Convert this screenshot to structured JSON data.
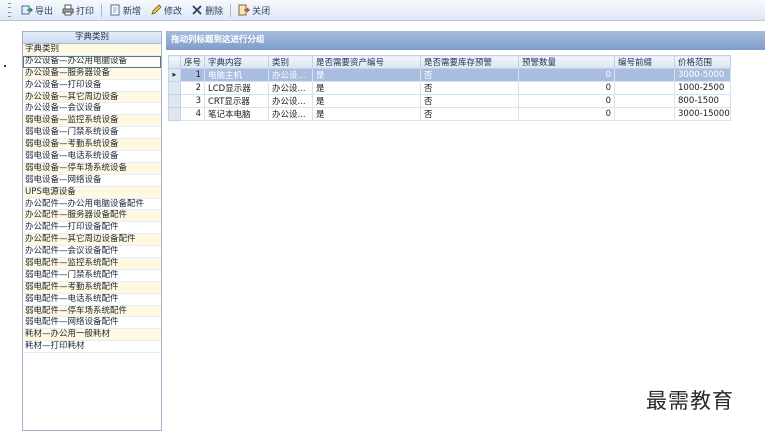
{
  "toolbar": {
    "export": "导出",
    "print": "打印",
    "new": "新增",
    "edit": "修改",
    "delete": "删除",
    "close": "关闭"
  },
  "left": {
    "header": "字典类别",
    "items": [
      "字典类别",
      "办公设备—办公用电脑设备",
      "办公设备—服务器设备",
      "办公设备—打印设备",
      "办公设备—其它周边设备",
      "办公设备—会议设备",
      "弱电设备—监控系统设备",
      "弱电设备—门禁系统设备",
      "弱电设备—考勤系统设备",
      "弱电设备—电话系统设备",
      "弱电设备—停车场系统设备",
      "弱电设备—网络设备",
      "UPS电源设备",
      "办公配件—办公用电脑设备配件",
      "办公配件—服务器设备配件",
      "办公配件—打印设备配件",
      "办公配件—其它周边设备配件",
      "办公配件—会议设备配件",
      "弱电配件—监控系统配件",
      "弱电配件—门禁系统配件",
      "弱电配件—考勤系统配件",
      "弱电配件—电话系统配件",
      "弱电配件—停车场系统配件",
      "弱电配件—网络设备配件",
      "耗材—办公用一般耗材",
      "耗材—打印耗材"
    ]
  },
  "grid": {
    "group_hint": "拖动列标题到这进行分组",
    "columns": [
      "序号",
      "字典内容",
      "类别",
      "是否需要资产编号",
      "是否需要库存预警",
      "预警数量",
      "编号前缀",
      "价格范围"
    ],
    "rows": [
      {
        "seq": "1",
        "content": "电脑主机",
        "category": "办公设...",
        "need_asset_no": "是",
        "need_alert": "否",
        "alert_qty": "0",
        "prefix": "",
        "price": "3000-5000"
      },
      {
        "seq": "2",
        "content": "LCD显示器",
        "category": "办公设...",
        "need_asset_no": "是",
        "need_alert": "否",
        "alert_qty": "0",
        "prefix": "",
        "price": "1000-2500"
      },
      {
        "seq": "3",
        "content": "CRT显示器",
        "category": "办公设...",
        "need_asset_no": "是",
        "need_alert": "否",
        "alert_qty": "0",
        "prefix": "",
        "price": "800-1500"
      },
      {
        "seq": "4",
        "content": "笔记本电脑",
        "category": "办公设...",
        "need_asset_no": "是",
        "need_alert": "否",
        "alert_qty": "0",
        "prefix": "",
        "price": "3000-15000"
      }
    ],
    "current_row_marker": "▸"
  },
  "watermark": "最需教育",
  "colors": {
    "selected_row": "#a9bde0",
    "group_bar": "#8fa8d3",
    "alt_list_row": "#fff9e1"
  }
}
